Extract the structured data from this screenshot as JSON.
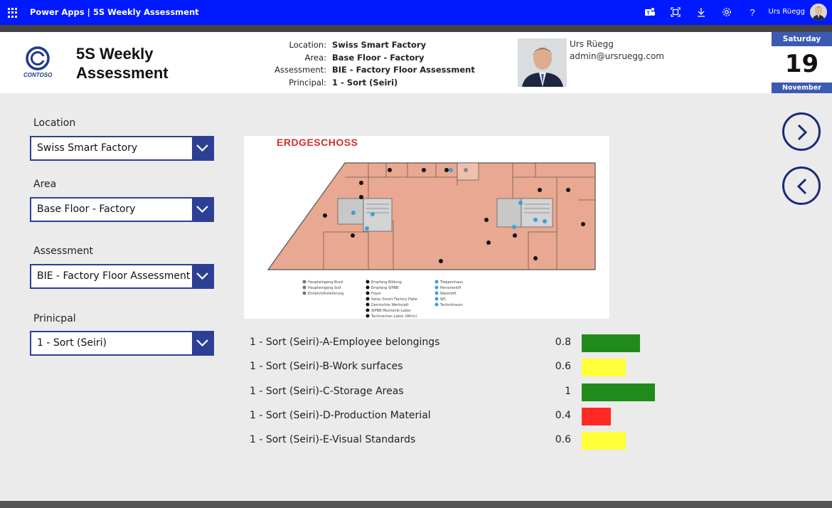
{
  "topbar": {
    "app_title": "Power Apps  |  5S Weekly Assessment",
    "user_name": "Urs Rüegg",
    "icons": [
      "waffle-icon",
      "teams-icon",
      "fit-screen-icon",
      "download-icon",
      "settings-icon",
      "help-icon"
    ]
  },
  "header": {
    "logo_text": "CONTOSO",
    "title": "5S Weekly Assessment",
    "info": [
      {
        "label": "Location:",
        "value": "Swiss Smart Factory"
      },
      {
        "label": "Area:",
        "value": "Base Floor - Factory"
      },
      {
        "label": "Assessment:",
        "value": "BIE - Factory Floor Assessment"
      },
      {
        "label": "Principal:",
        "value": "1 - Sort (Seiri)"
      }
    ],
    "person_name": "Urs Rüegg",
    "person_email": "admin@ursruegg.com"
  },
  "date": {
    "weekday": "Saturday",
    "day": "19",
    "month": "November"
  },
  "filters": [
    {
      "label": "Location",
      "value": "Swiss Smart Factory"
    },
    {
      "label": "Area",
      "value": "Base Floor - Factory"
    },
    {
      "label": "Assessment",
      "value": "BIE - Factory Floor Assessment"
    },
    {
      "label": "Prinicpal",
      "value": "1 - Sort (Seiri)"
    }
  ],
  "floorplan": {
    "title": "ERDGESCHOSS"
  },
  "scores": [
    {
      "label": "1 - Sort (Seiri)-A-Employee belongings",
      "value": "0.8",
      "fraction": 0.8,
      "color": "#218a1c"
    },
    {
      "label": "1 - Sort (Seiri)-B-Work surfaces",
      "value": "0.6",
      "fraction": 0.6,
      "color": "#ffff3a"
    },
    {
      "label": "1 - Sort (Seiri)-C-Storage Areas",
      "value": "1",
      "fraction": 1.0,
      "color": "#218a1c"
    },
    {
      "label": "1 - Sort (Seiri)-D-Production Material",
      "value": "0.4",
      "fraction": 0.4,
      "color": "#ff2a24"
    },
    {
      "label": "1 - Sort (Seiri)-E-Visual Standards",
      "value": "0.6",
      "fraction": 0.6,
      "color": "#ffff3a"
    }
  ],
  "nav": {
    "next_icon": "chevron-right-icon",
    "back_icon": "chevron-left-icon"
  }
}
